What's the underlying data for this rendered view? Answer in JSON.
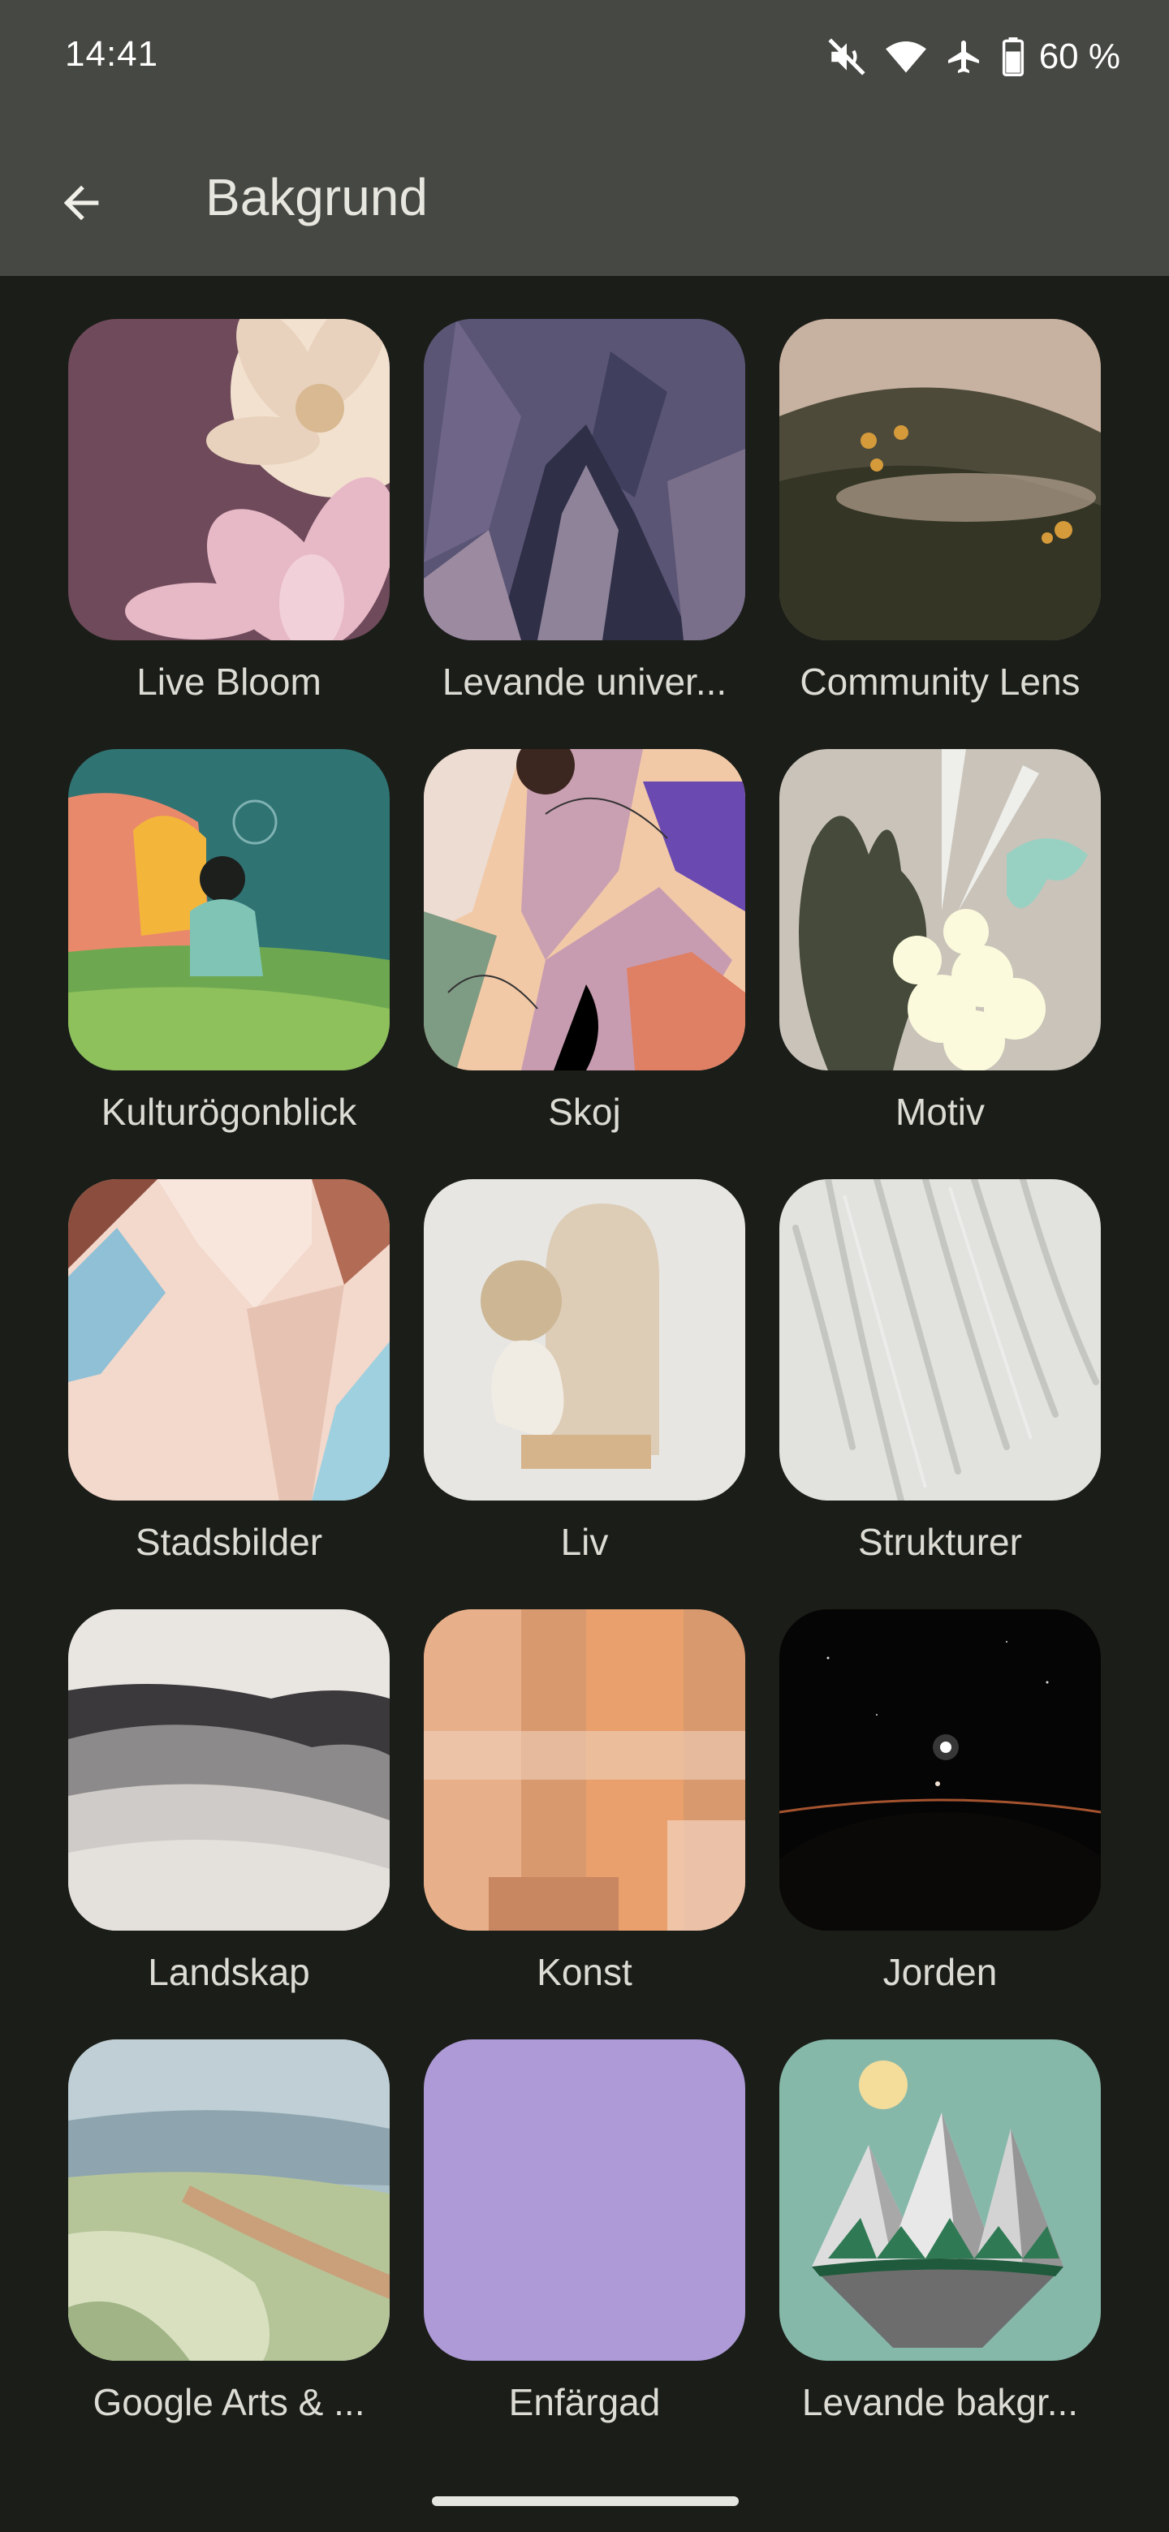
{
  "status_bar": {
    "time": "14:41",
    "battery": "60 %",
    "icons": [
      "mute-icon",
      "wifi-icon",
      "airplane-icon",
      "battery-icon"
    ]
  },
  "toolbar": {
    "title": "Bakgrund",
    "back_icon": "arrow-left-icon"
  },
  "categories": [
    {
      "label": "Live Bloom"
    },
    {
      "label": "Levande univer..."
    },
    {
      "label": "Community Lens"
    },
    {
      "label": "Kulturögonblick"
    },
    {
      "label": "Skoj"
    },
    {
      "label": "Motiv"
    },
    {
      "label": "Stadsbilder"
    },
    {
      "label": "Liv"
    },
    {
      "label": "Strukturer"
    },
    {
      "label": "Landskap"
    },
    {
      "label": "Konst"
    },
    {
      "label": "Jorden"
    },
    {
      "label": "Google Arts & ..."
    },
    {
      "label": "Enfärgad"
    },
    {
      "label": "Levande bakgr..."
    }
  ],
  "colors": {
    "background": "#1b1d18",
    "appbar": "#464843",
    "solid_color_swatch": "#ad9ad6"
  }
}
